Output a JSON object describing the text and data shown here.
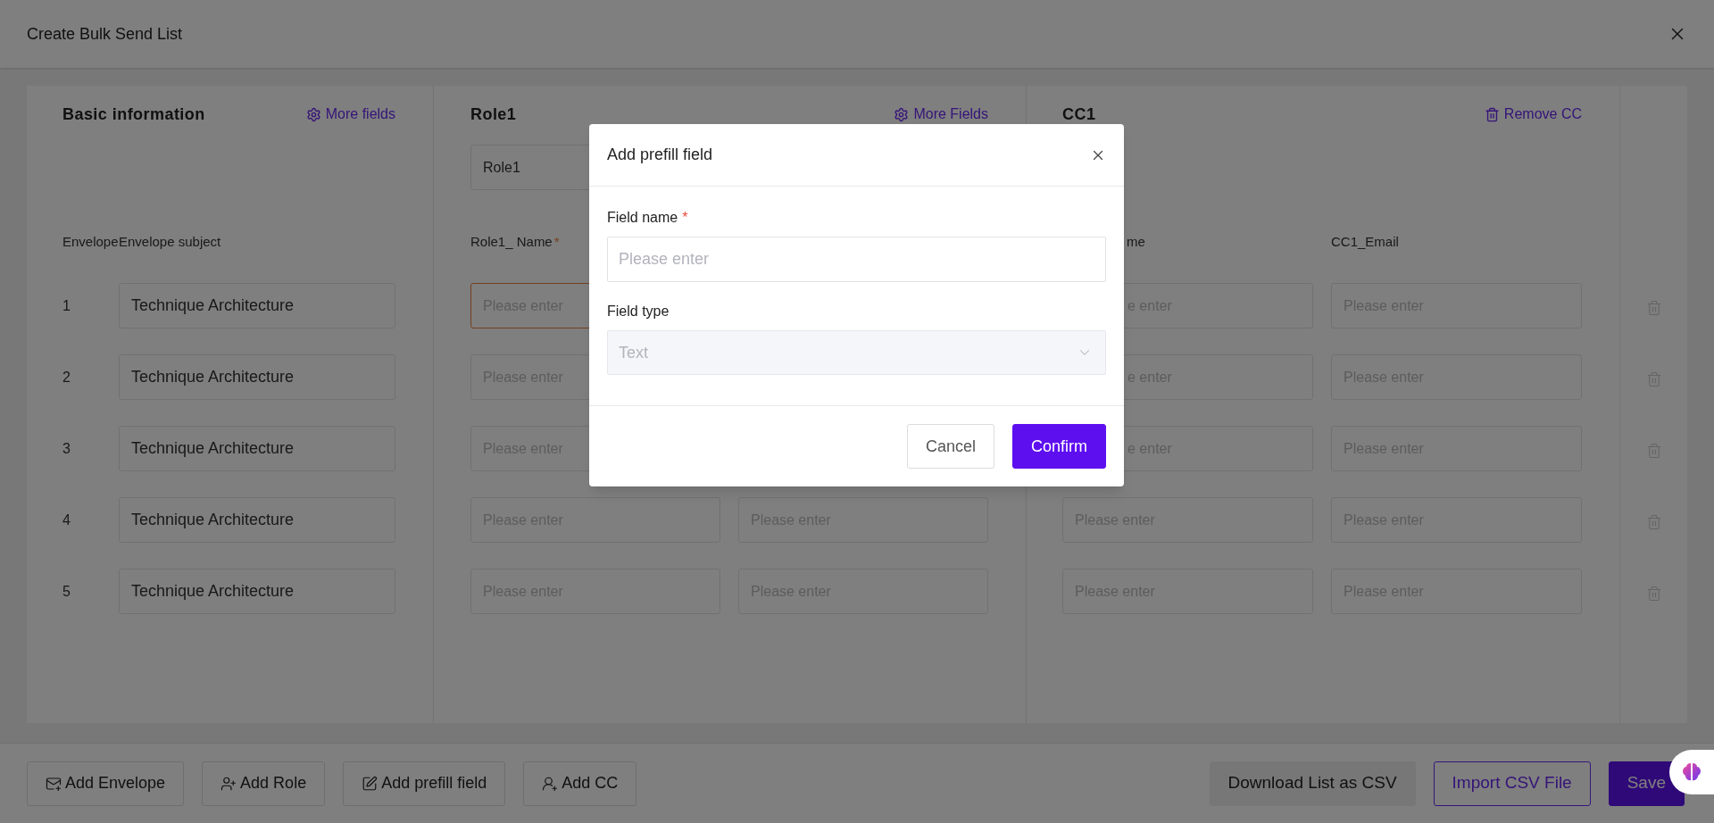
{
  "window": {
    "title": "Create Bulk Send List"
  },
  "basic_info": {
    "title": "Basic information",
    "more_fields": "More fields",
    "columns": [
      "Envelope",
      "Envelope subject"
    ]
  },
  "role": {
    "title": "Role1",
    "more_fields": "More Fields",
    "name_value": "Role1",
    "column_1": {
      "label": "Role1_ Name",
      "required_mark": "*"
    }
  },
  "cc": {
    "title": "CC1",
    "remove": "Remove CC",
    "column_1": "me",
    "column_2": "CC1_Email"
  },
  "rows": [
    {
      "number": "1",
      "subject": "Technique Architecture",
      "role_column_1": {
        "placeholder": "Please enter",
        "error": true
      },
      "cc_column_1": {
        "placeholder": "e enter"
      },
      "cc_column_2": {
        "placeholder": "Please enter"
      }
    },
    {
      "number": "2",
      "subject": "Technique Architecture",
      "role_column_1": {
        "placeholder": "Please enter",
        "error": false
      },
      "cc_column_1": {
        "placeholder": "e enter"
      },
      "cc_column_2": {
        "placeholder": "Please enter"
      }
    },
    {
      "number": "3",
      "subject": "Technique Architecture",
      "role_column_1": {
        "placeholder": "Please enter",
        "error": false
      },
      "cc_column_1": {
        "placeholder": "e enter"
      },
      "cc_column_2": {
        "placeholder": "Please enter"
      }
    },
    {
      "number": "4",
      "subject": "Technique Architecture",
      "role_column_1": {
        "placeholder": "Please enter",
        "error": false
      },
      "role_column_2": {
        "placeholder": "Please enter"
      },
      "cc_column_1": {
        "placeholder": "Please enter"
      },
      "cc_column_2": {
        "placeholder": "Please enter"
      }
    },
    {
      "number": "5",
      "subject": "Technique Architecture",
      "role_column_1": {
        "placeholder": "Please enter",
        "error": false
      },
      "role_column_2": {
        "placeholder": "Please enter"
      },
      "cc_column_1": {
        "placeholder": "Please enter"
      },
      "cc_column_2": {
        "placeholder": "Please enter"
      }
    }
  ],
  "footer": {
    "left_buttons": [
      {
        "label": "Add Envelope",
        "kind": "envelope"
      },
      {
        "label": "Add Role",
        "kind": "role"
      },
      {
        "label": "Add prefill field",
        "kind": "prefill"
      },
      {
        "label": "Add CC",
        "kind": "cc"
      }
    ],
    "right_buttons": [
      {
        "label": "Download List as CSV",
        "kind": "secondary"
      },
      {
        "label": "Import CSV File",
        "kind": "outline"
      },
      {
        "label": "Save",
        "kind": "primary"
      }
    ]
  },
  "dialog": {
    "title": "Add prefill field",
    "fields": [
      {
        "kind": "input",
        "label": "Field name",
        "required_mark": "*",
        "placeholder": "Please enter"
      },
      {
        "kind": "select",
        "label": "Field type",
        "value": "Text",
        "disabled": true
      }
    ],
    "buttons": [
      {
        "label": "Cancel",
        "kind": "secondary"
      },
      {
        "label": "Confirm",
        "kind": "primary"
      }
    ]
  }
}
